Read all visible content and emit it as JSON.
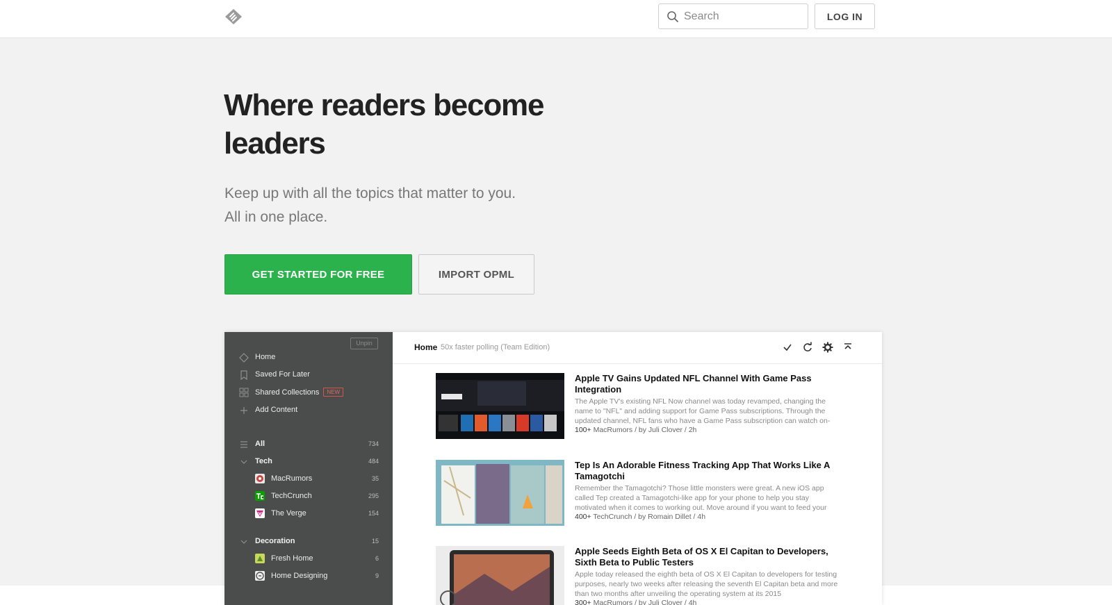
{
  "header": {
    "logo_icon": "feedly-logo-icon",
    "search_placeholder": "Search",
    "login_label": "LOG IN"
  },
  "hero": {
    "title": "Where readers become leaders",
    "subtitle_line1": "Keep up with all the topics that matter to you.",
    "subtitle_line2": "All in one place.",
    "cta_primary": "GET STARTED FOR FREE",
    "cta_secondary": "IMPORT OPML",
    "accent_color": "#2bb24c"
  },
  "app": {
    "sidebar": {
      "unpin_label": "Unpin",
      "nav": [
        {
          "label": "Home",
          "icon": "home-icon"
        },
        {
          "label": "Saved For Later",
          "icon": "bookmark-icon"
        },
        {
          "label": "Shared Collections",
          "icon": "grid-icon",
          "badge": "NEW"
        },
        {
          "label": "Add Content",
          "icon": "plus-icon"
        }
      ],
      "all": {
        "label": "All",
        "count": "734"
      },
      "tech": {
        "label": "Tech",
        "count": "484"
      },
      "tech_feeds": [
        {
          "label": "MacRumors",
          "count": "35"
        },
        {
          "label": "TechCrunch",
          "count": "295"
        },
        {
          "label": "The Verge",
          "count": "154"
        }
      ],
      "decoration": {
        "label": "Decoration",
        "count": "15"
      },
      "decoration_feeds": [
        {
          "label": "Fresh Home",
          "count": "6"
        },
        {
          "label": "Home Designing",
          "count": "9"
        }
      ]
    },
    "main": {
      "title": "Home",
      "subtitle": "50x faster polling (Team Edition)",
      "toolbar_icons": [
        "check-icon",
        "refresh-icon",
        "settings-icon",
        "collapse-up-icon"
      ],
      "articles": [
        {
          "title": "Apple TV Gains Updated NFL Channel With Game Pass Integration",
          "body": "The Apple TV's existing NFL Now channel was today revamped, changing the name to \"NFL\" and adding support for Game Pass subscriptions. Through the updated channel, NFL fans who have a Game Pass subscription can watch on-",
          "popularity": "100+",
          "meta": " MacRumors / by Juli Clover / 2h"
        },
        {
          "title": "Tep Is An Adorable Fitness Tracking App That Works Like A Tamagotchi",
          "body": "Remember the Tamagotchi? Those little monsters were great. A new iOS app called Tep created a Tamagotchi-like app for your phone to help you stay motivated when it comes to working out. Move around if you want to feed your",
          "popularity": "400+",
          "meta": " TechCrunch / by Romain Dillet / 4h"
        },
        {
          "title": "Apple Seeds Eighth Beta of OS X El Capitan to Developers, Sixth Beta to Public Testers",
          "body": "Apple today released the eighth beta of OS X El Capitan to developers for testing purposes, nearly two weeks after releasing the seventh El Capitan beta and more than two months after unveiling the operating system at its 2015",
          "popularity": "300+",
          "meta": " MacRumors / by Juli Clover / 4h"
        }
      ]
    }
  }
}
